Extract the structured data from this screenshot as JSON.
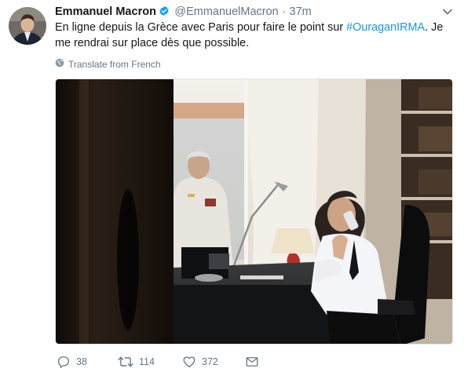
{
  "tweet": {
    "author_name": "Emmanuel Macron",
    "handle": "@EmmanuelMacron",
    "separator": "·",
    "time": "37m",
    "text_before": "En ligne depuis la Grèce avec Paris pour faire le point sur ",
    "hashtag": "#OuraganIRMA",
    "text_after": ". Je me rendrai sur place dès que possible.",
    "translate_label": "Translate from French"
  },
  "actions": {
    "replies": "38",
    "retweets": "114",
    "likes": "372"
  },
  "icons": {
    "verified": "verified-badge-icon",
    "caret": "chevron-down-icon",
    "globe": "globe-icon",
    "reply": "reply-icon",
    "retweet": "retweet-icon",
    "like": "heart-icon",
    "message": "envelope-icon"
  },
  "colors": {
    "text": "#14171a",
    "secondary": "#657786",
    "link": "#1b95e0",
    "verified": "#1da1f2"
  }
}
